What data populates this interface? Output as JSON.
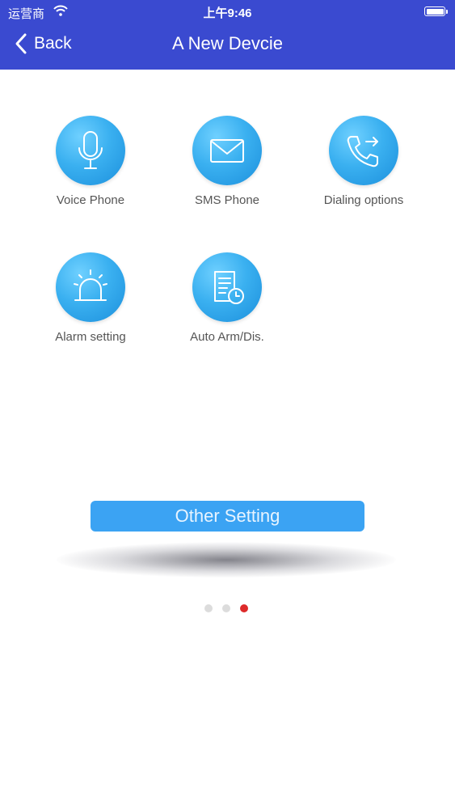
{
  "status_bar": {
    "carrier": "运营商",
    "time": "上午9:46"
  },
  "nav": {
    "back_label": "Back",
    "title": "A New Devcie"
  },
  "menu": {
    "items": [
      {
        "label": "Voice Phone",
        "icon": "microphone-icon"
      },
      {
        "label": "SMS Phone",
        "icon": "envelope-icon"
      },
      {
        "label": "Dialing options",
        "icon": "phone-forward-icon"
      },
      {
        "label": "Alarm setting",
        "icon": "siren-icon"
      },
      {
        "label": "Auto Arm/Dis.",
        "icon": "schedule-doc-icon"
      }
    ]
  },
  "other_setting_label": "Other Setting",
  "pager": {
    "pages": 3,
    "active_index": 2
  },
  "colors": {
    "header": "#3a4ad0",
    "icon_circle": "#3ab0f0",
    "button": "#3ba3f3",
    "active_dot": "#dd2a2a"
  }
}
